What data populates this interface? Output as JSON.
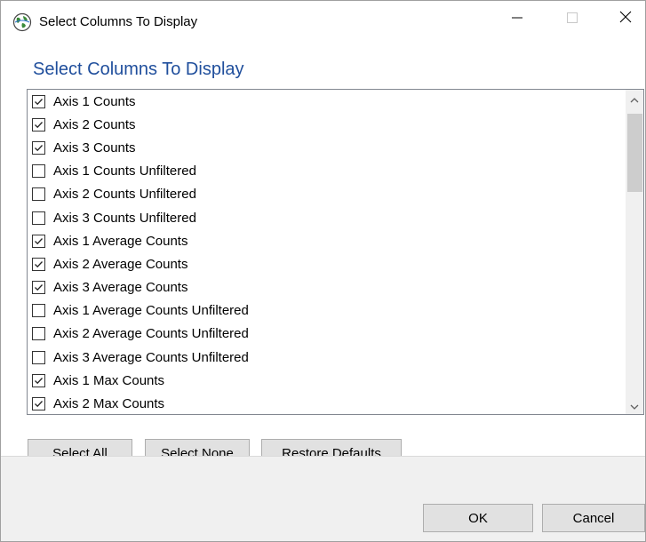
{
  "window": {
    "title": "Select Columns To Display",
    "app_icon": "globe-icon"
  },
  "heading": "Select Columns To Display",
  "columns": [
    {
      "label": "Axis 1 Counts",
      "checked": true
    },
    {
      "label": "Axis 2 Counts",
      "checked": true
    },
    {
      "label": "Axis 3 Counts",
      "checked": true
    },
    {
      "label": "Axis 1 Counts Unfiltered",
      "checked": false
    },
    {
      "label": "Axis 2 Counts Unfiltered",
      "checked": false
    },
    {
      "label": "Axis 3 Counts Unfiltered",
      "checked": false
    },
    {
      "label": "Axis 1 Average Counts",
      "checked": true
    },
    {
      "label": "Axis 2 Average Counts",
      "checked": true
    },
    {
      "label": "Axis 3 Average Counts",
      "checked": true
    },
    {
      "label": "Axis 1 Average Counts Unfiltered",
      "checked": false
    },
    {
      "label": "Axis 2 Average Counts Unfiltered",
      "checked": false
    },
    {
      "label": "Axis 3 Average Counts Unfiltered",
      "checked": false
    },
    {
      "label": "Axis 1 Max Counts",
      "checked": true
    },
    {
      "label": "Axis 2 Max Counts",
      "checked": true
    }
  ],
  "buttons": {
    "select_all": "Select All",
    "select_none": "Select None",
    "restore_defaults": "Restore Defaults",
    "ok": "OK",
    "cancel": "Cancel"
  }
}
